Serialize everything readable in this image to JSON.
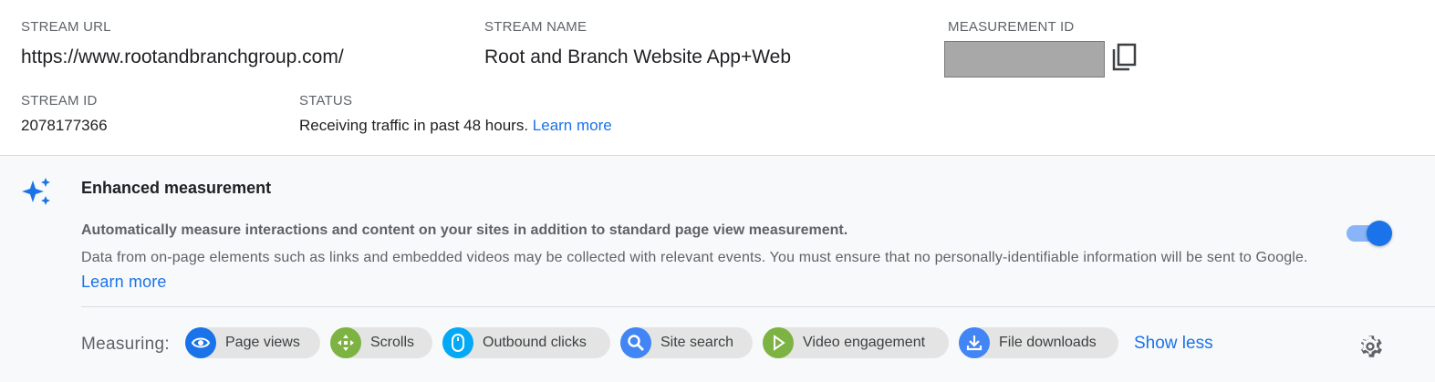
{
  "stream_url": {
    "label": "STREAM URL",
    "value": "https://www.rootandbranchgroup.com/"
  },
  "stream_name": {
    "label": "STREAM NAME",
    "value": "Root and Branch Website App+Web"
  },
  "measurement_id": {
    "label": "MEASUREMENT ID",
    "copy_icon": "copy-icon"
  },
  "stream_id": {
    "label": "STREAM ID",
    "value": "2078177366"
  },
  "status": {
    "label": "STATUS",
    "text": "Receiving traffic in past 48 hours.",
    "link": "Learn more"
  },
  "enhanced": {
    "icon": "sparkle-icon",
    "title": "Enhanced measurement",
    "desc_bold": "Automatically measure interactions and content on your sites in addition to standard page view measurement.",
    "desc": "Data from on-page elements such as links and embedded videos may be collected with relevant events. You must ensure that no personally-identifiable information will be sent to Google.",
    "link": "Learn more",
    "enabled": true
  },
  "measuring": {
    "label": "Measuring:",
    "chips": [
      {
        "label": "Page views",
        "icon": "eye-icon",
        "color": "#1a73e8"
      },
      {
        "label": "Scrolls",
        "icon": "scroll-arrows-icon",
        "color": "#7cb342"
      },
      {
        "label": "Outbound clicks",
        "icon": "mouse-icon",
        "color": "#03a9f4"
      },
      {
        "label": "Site search",
        "icon": "search-icon",
        "color": "#4285f4"
      },
      {
        "label": "Video engagement",
        "icon": "play-icon",
        "color": "#7cb342"
      },
      {
        "label": "File downloads",
        "icon": "download-icon",
        "color": "#4285f4"
      }
    ],
    "show_less": "Show less",
    "settings_icon": "gear-icon"
  }
}
